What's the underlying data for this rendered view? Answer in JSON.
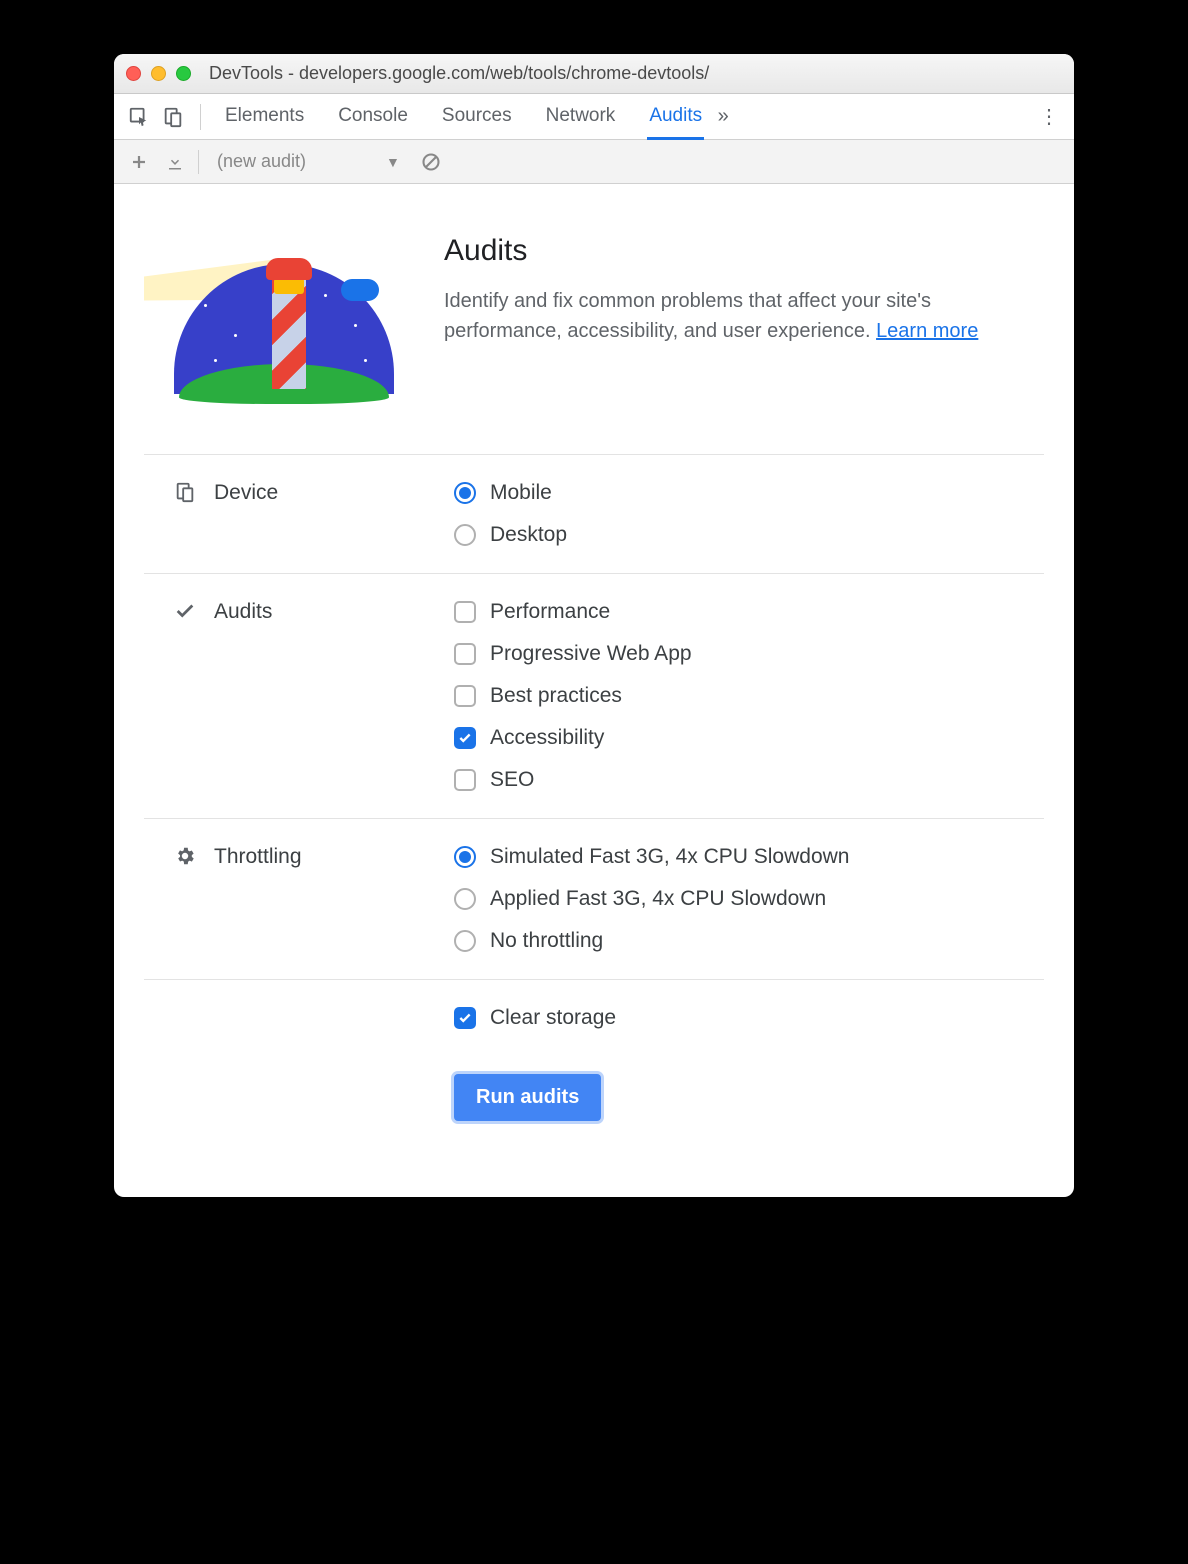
{
  "window": {
    "title": "DevTools - developers.google.com/web/tools/chrome-devtools/"
  },
  "tabs": {
    "items": [
      "Elements",
      "Console",
      "Sources",
      "Network",
      "Audits"
    ],
    "active": "Audits"
  },
  "toolbar": {
    "audit_select": "(new audit)"
  },
  "intro": {
    "heading": "Audits",
    "description": "Identify and fix common problems that affect your site's performance, accessibility, and user experience. ",
    "learn_more": "Learn more"
  },
  "sections": {
    "device": {
      "label": "Device",
      "options": [
        {
          "label": "Mobile",
          "checked": true
        },
        {
          "label": "Desktop",
          "checked": false
        }
      ]
    },
    "audits": {
      "label": "Audits",
      "options": [
        {
          "label": "Performance",
          "checked": false
        },
        {
          "label": "Progressive Web App",
          "checked": false
        },
        {
          "label": "Best practices",
          "checked": false
        },
        {
          "label": "Accessibility",
          "checked": true
        },
        {
          "label": "SEO",
          "checked": false
        }
      ]
    },
    "throttling": {
      "label": "Throttling",
      "options": [
        {
          "label": "Simulated Fast 3G, 4x CPU Slowdown",
          "checked": true
        },
        {
          "label": "Applied Fast 3G, 4x CPU Slowdown",
          "checked": false
        },
        {
          "label": "No throttling",
          "checked": false
        }
      ]
    },
    "storage": {
      "label": "Clear storage",
      "checked": true
    }
  },
  "run_button": "Run audits"
}
